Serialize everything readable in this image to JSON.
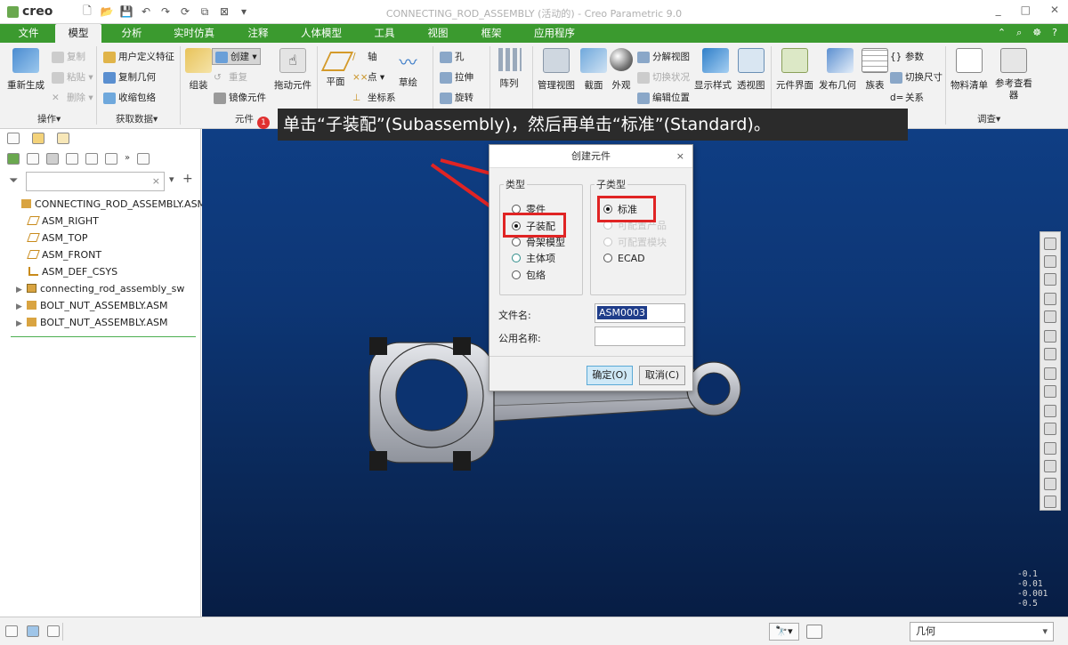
{
  "titlebar": {
    "logo": "creo",
    "window_title": "CONNECTING_ROD_ASSEMBLY (活动的) - Creo Parametric 9.0",
    "controls": [
      "_",
      "□",
      "✕"
    ]
  },
  "menubar": {
    "tabs": [
      "文件",
      "模型",
      "分析",
      "实时仿真",
      "注释",
      "人体模型",
      "工具",
      "视图",
      "框架",
      "应用程序"
    ],
    "active": "模型"
  },
  "ribbon": {
    "regenerate": "重新生成",
    "copy": "复制",
    "paste": "粘贴",
    "delete": "删除",
    "udf": "用户定义特征",
    "copy_geom": "复制几何",
    "shrinkwrap": "收缩包络",
    "assemble": "组装",
    "create": "创建",
    "repeat": "重复",
    "mirror": "镜像元件",
    "drag": "拖动元件",
    "plane": "平面",
    "axis": "轴",
    "point": "点",
    "csys": "坐标系",
    "sketch": "草绘",
    "hole": "孔",
    "extrude": "拉伸",
    "revolve": "旋转",
    "pattern": "阵列",
    "manage_views": "管理视图",
    "section": "截面",
    "appearance": "外观",
    "explode": "分解视图",
    "toggle_status": "切换状况",
    "edit_position": "编辑位置",
    "display_style": "显示样式",
    "perspective": "透视图",
    "comp_interface": "元件界面",
    "publish_geom": "发布几何",
    "family_table": "族表",
    "params": "参数",
    "switch_dims": "切换尺寸",
    "relations": "关系",
    "bom": "物料清单",
    "ref_viewer": "参考查看器",
    "groups": {
      "operations": "操作▾",
      "get_data": "获取数据▾",
      "component": "元件",
      "investigate": "调查▾"
    }
  },
  "tooltip": {
    "step": "1",
    "text": "单击“子装配”(Subassembly)，然后再单击“标准”(Standard)。"
  },
  "tree": {
    "items": [
      {
        "label": "CONNECTING_ROD_ASSEMBLY.ASM",
        "expand": "",
        "icon": "assembly-icon"
      },
      {
        "label": "ASM_RIGHT",
        "expand": "",
        "icon": "datum-plane-icon"
      },
      {
        "label": "ASM_TOP",
        "expand": "",
        "icon": "datum-plane-icon"
      },
      {
        "label": "ASM_FRONT",
        "expand": "",
        "icon": "datum-plane-icon"
      },
      {
        "label": "ASM_DEF_CSYS",
        "expand": "",
        "icon": "csys-icon"
      },
      {
        "label": "connecting_rod_assembly_sw",
        "expand": "▶",
        "icon": "part-icon"
      },
      {
        "label": "BOLT_NUT_ASSEMBLY.ASM",
        "expand": "▶",
        "icon": "assembly-icon"
      },
      {
        "label": "BOLT_NUT_ASSEMBLY.ASM",
        "expand": "▶",
        "icon": "assembly-icon"
      }
    ]
  },
  "dialog": {
    "title": "创建元件",
    "close": "×",
    "type_legend": "类型",
    "subtype_legend": "子类型",
    "types": [
      "零件",
      "子装配",
      "骨架模型",
      "主体项",
      "包络"
    ],
    "selected_type": "子装配",
    "subtypes": [
      "标准",
      "可配置产品",
      "可配置模块",
      "ECAD"
    ],
    "selected_subtype": "标准",
    "file_name_label": "文件名:",
    "file_name_value": "ASM0003",
    "common_name_label": "公用名称:",
    "ok": "确定(O)",
    "cancel": "取消(C)"
  },
  "coords": [
    "-0.1",
    "-0.01",
    "-0.001",
    "-0.5"
  ],
  "statusbar": {
    "filter_value": "几何"
  },
  "colors": {
    "accent_green": "#3b9a2f",
    "highlight_red": "#e02424",
    "canvas_top": "#0f3e84",
    "canvas_bottom": "#071d44"
  }
}
